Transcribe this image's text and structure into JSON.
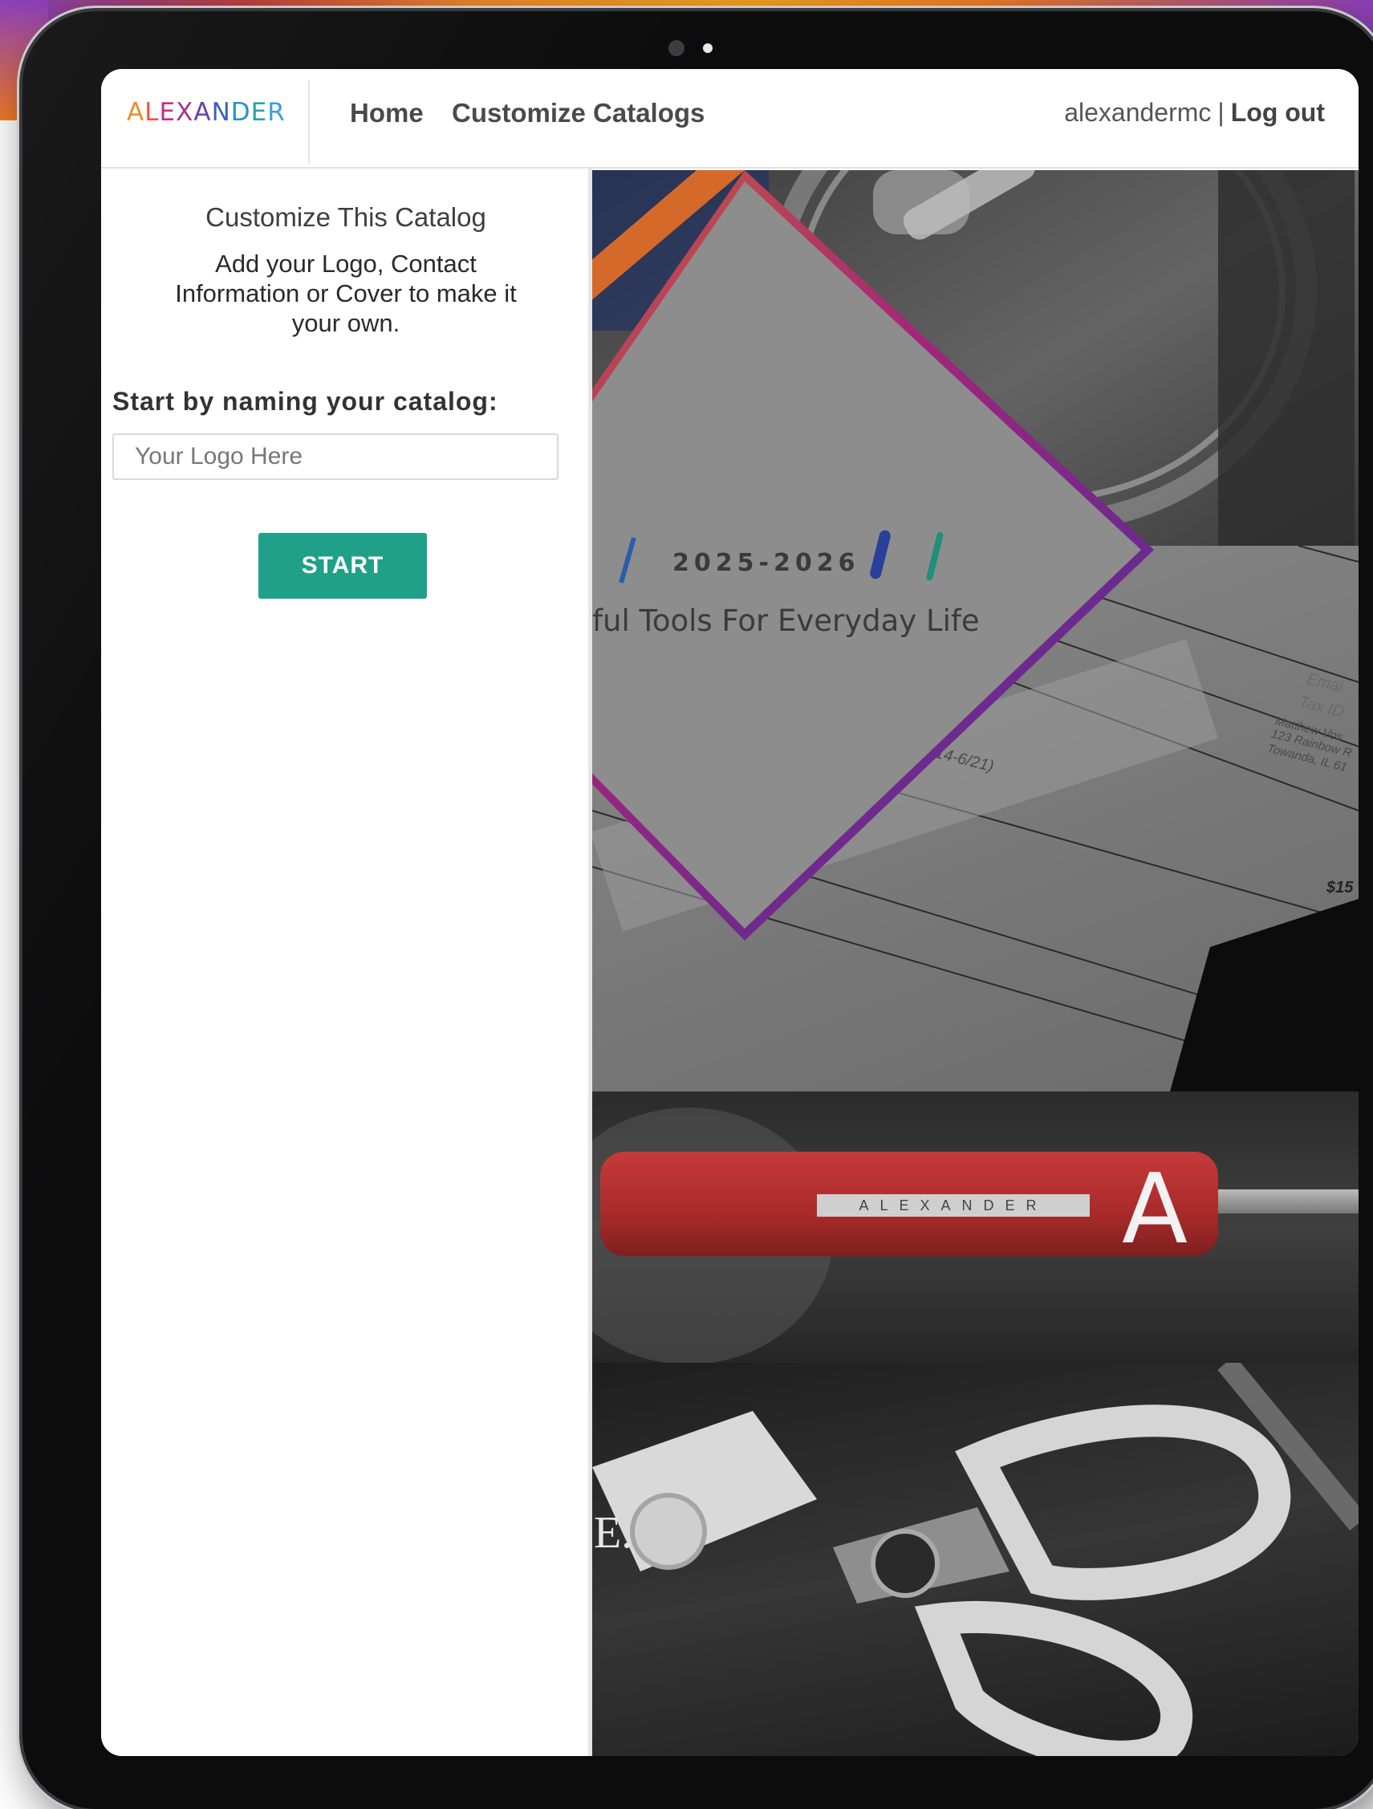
{
  "colors": {
    "accent": "#20a089",
    "logo_letters": [
      "#f08a2a",
      "#e8553f",
      "#c42f8a",
      "#a4368f",
      "#6a3fb0",
      "#3f5fc0",
      "#2a90c9",
      "#28a5a0",
      "#3a9fd8"
    ]
  },
  "nav": {
    "logo_text": "ALEXANDER",
    "home_label": "Home",
    "customize_label": "Customize Catalogs",
    "username": "alexandermc",
    "separator": "|",
    "logout_label": "Log out"
  },
  "sidebar": {
    "title": "Customize This Catalog",
    "description": "Add your Logo, Contact Information or Cover to make it your own.",
    "name_label": "Start by naming your catalog:",
    "input_placeholder": "Your Logo Here",
    "input_value": "",
    "start_label": "START"
  },
  "preview": {
    "cover_year": "2025-2026",
    "cover_tagline": "ful Tools For Everyday Life",
    "form_text_1": "1\" (6/14-6/21)",
    "form_text_2": "Emai",
    "form_text_3": "Tax ID",
    "form_text_4": "Matthew Vos",
    "form_text_5": "123 Rainbow R",
    "form_text_6": "Towanda, IL 61",
    "form_price": "$15",
    "handle_engraving": "ALEXANDER",
    "scissors_brand": "E."
  }
}
